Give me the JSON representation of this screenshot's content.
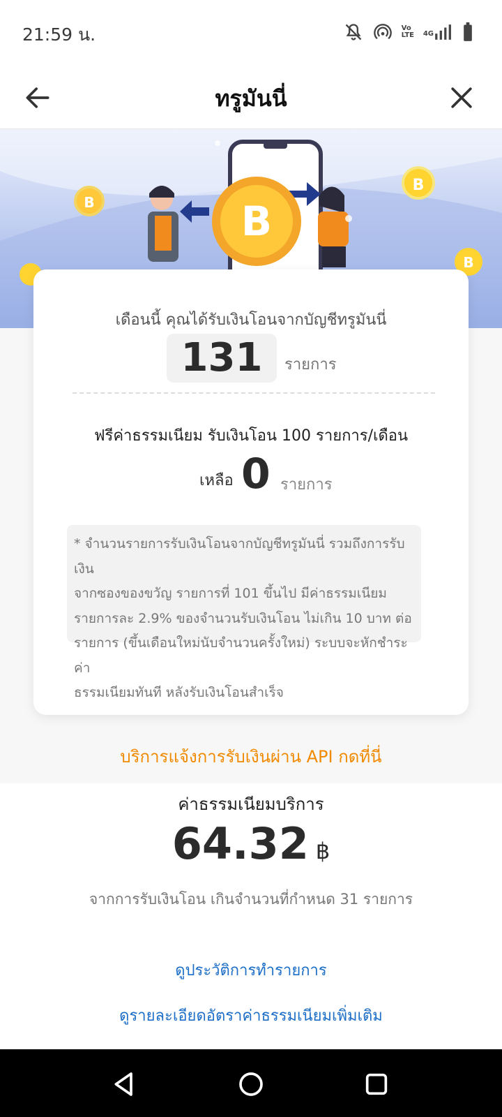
{
  "status": {
    "time": "21:59 น.",
    "icons": [
      "bell-off-icon",
      "hotspot-icon",
      "volte-icon",
      "signal-icon",
      "battery-icon"
    ],
    "volte_text": "Vo LTE",
    "network_text": "4G"
  },
  "header": {
    "title": "ทรูมันนี่",
    "back_icon": "arrow-left-icon",
    "close_icon": "close-icon"
  },
  "banner": {
    "illustration": "money-transfer-illustration"
  },
  "summary": {
    "received_text": "เดือนนี้ คุณได้รับเงินโอนจากบัญชีทรูมันนี่",
    "received_count": "131",
    "received_unit": "รายการ",
    "free_text": "ฟรีค่าธรรมเนียม รับเงินโอน 100 รายการ/เดือน",
    "remaining_label": "เหลือ",
    "remaining_count": "0",
    "remaining_unit": "รายการ",
    "note_line1": "* จำนวนรายการรับเงินโอนจากบัญชีทรูมันนี่ รวมถึงการรับเงิน",
    "note_line2": "จากซองของขวัญ รายการที่ 101 ขึ้นไป มีค่าธรรมเนียม",
    "note_line3": "รายการละ 2.9% ของจำนวนรับเงินโอน ไม่เกิน 10 บาท ต่อ",
    "note_line4": "รายการ (ขึ้นเดือนใหม่นับจำนวนครั้งใหม่) ระบบจะหักชำระค่า",
    "note_line5": "ธรรมเนียมทันที หลังรับเงินโอนสำเร็จ"
  },
  "api_link": "บริการแจ้งการรับเงินผ่าน API กดที่นี่",
  "fee": {
    "title": "ค่าธรรมเนียมบริการ",
    "amount": "64.32",
    "currency": "฿",
    "description": "จากการรับเงินโอน เกินจำนวนที่กำหนด 31 รายการ"
  },
  "links": {
    "history": "ดูประวัติการทำรายการ",
    "rates": "ดูรายละเอียดอัตราค่าธรรมเนียมเพิ่มเติม"
  },
  "navbar": {
    "back": "nav-back-icon",
    "home": "nav-home-icon",
    "recents": "nav-recents-icon"
  }
}
